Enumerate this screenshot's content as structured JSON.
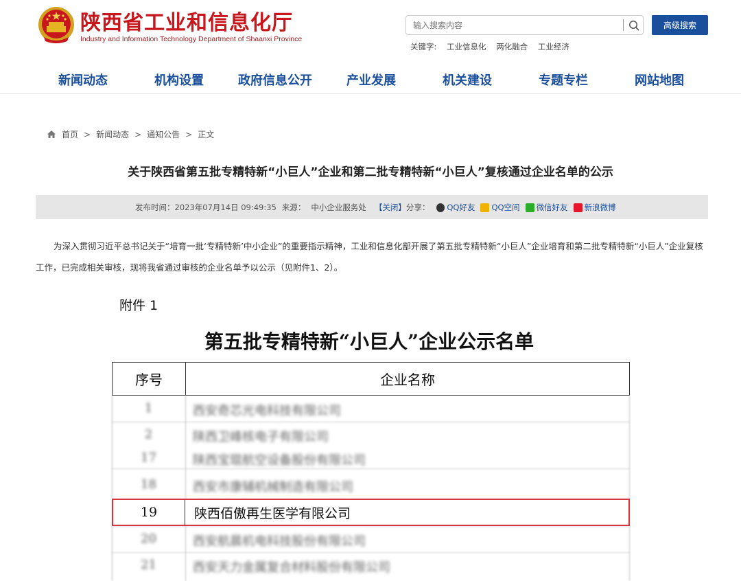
{
  "header": {
    "site_title": "陕西省工业和信息化厅",
    "site_subtitle": "Industry and Information Technology Department of Shaanxi Province",
    "emblem_icon": "national-emblem-icon"
  },
  "search": {
    "placeholder": "输入搜索内容",
    "advanced_label": "高级搜索",
    "keywords_label": "关键字:",
    "keywords": [
      "工业信息化",
      "两化融合",
      "工业经济"
    ]
  },
  "nav": {
    "items": [
      "新闻动态",
      "机构设置",
      "政府信息公开",
      "产业发展",
      "机关建设",
      "专题专栏",
      "网站地图"
    ]
  },
  "breadcrumb": {
    "items": [
      "首页",
      "新闻动态",
      "通知公告",
      "正文"
    ],
    "separator": ">"
  },
  "article": {
    "title": "关于陕西省第五批专精特新“小巨人”企业和第二批专精特新“小巨人”复核通过企业名单的公示",
    "publish_label": "发布时间：2023年07月14日 09:49:35",
    "source_label": "来源：",
    "source": "中小企业服务处",
    "close_label": "【关闭】",
    "share_label": "分享：",
    "share": [
      "QQ好友",
      "QQ空间",
      "微信好友",
      "新浪微博"
    ],
    "paragraph": "为深入贯彻习近平总书记关于“培育一批‘专精特新’中小企业”的重要指示精神，工业和信息化部开展了第五批专精特新“小巨人”企业培育和第二批专精特新“小巨人”企业复核工作，已完成相关审核，现将我省通过审核的企业名单予以公示（见附件1、2）。"
  },
  "attachment": {
    "label": "附件 1",
    "title": "第五批专精特新“小巨人”企业公示名单",
    "columns": [
      "序号",
      "企业名称"
    ],
    "blurred_rows": [
      {
        "no": "1",
        "name": "西安奇芯光电科技有限公司"
      },
      {
        "no": "2",
        "name": "陕西卫峰核电子有限公司"
      },
      {
        "no": "17",
        "name": "陕西宝琨航空设备股份有限公司"
      },
      {
        "no": "18",
        "name": "西安市康辅机械制造有限公司"
      },
      {
        "no": "20",
        "name": "西安航晨机电科技股份有限公司"
      },
      {
        "no": "21",
        "name": "西安天力金属复合材料股份有限公司"
      }
    ],
    "highlight_row": {
      "no": "19",
      "name": "陕西佰傲再生医学有限公司"
    },
    "highlight_color": "#d9343b"
  },
  "colors": {
    "brand_red": "#c8161d",
    "nav_blue": "#1a4f9c"
  }
}
